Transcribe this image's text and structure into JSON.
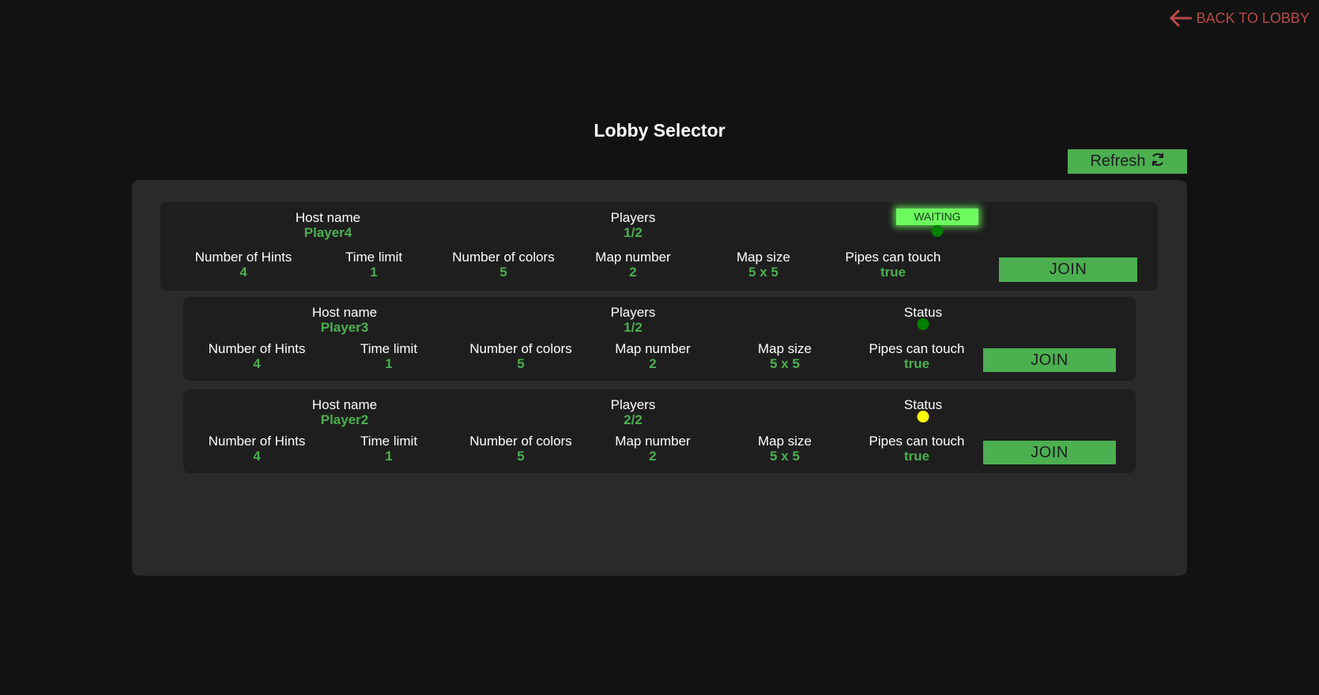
{
  "header": {
    "back_label": "BACK TO LOBBY",
    "title": "Lobby Selector",
    "refresh_label": "Refresh"
  },
  "labels": {
    "host_name": "Host name",
    "players": "Players",
    "status": "Status",
    "hints": "Number of Hints",
    "time_limit": "Time limit",
    "colors": "Number of colors",
    "map_number": "Map number",
    "map_size": "Map size",
    "pipes_touch": "Pipes can touch",
    "join": "JOIN"
  },
  "lobbies": [
    {
      "host": "Player4",
      "players": "1/2",
      "status_text": "WAITING",
      "status_color": "#008000",
      "hints": "4",
      "time_limit": "1",
      "colors": "5",
      "map_number": "2",
      "map_size": "5 x 5",
      "pipes_touch": "true"
    },
    {
      "host": "Player3",
      "players": "1/2",
      "status_color": "#008000",
      "hints": "4",
      "time_limit": "1",
      "colors": "5",
      "map_number": "2",
      "map_size": "5 x 5",
      "pipes_touch": "true"
    },
    {
      "host": "Player2",
      "players": "2/2",
      "status_color": "#ffff00",
      "hints": "4",
      "time_limit": "1",
      "colors": "5",
      "map_number": "2",
      "map_size": "5 x 5",
      "pipes_touch": "true"
    }
  ],
  "colors": {
    "accent": "#4caf50",
    "back_link": "#b84a4a",
    "waiting_chip": "#6dfa5f"
  }
}
